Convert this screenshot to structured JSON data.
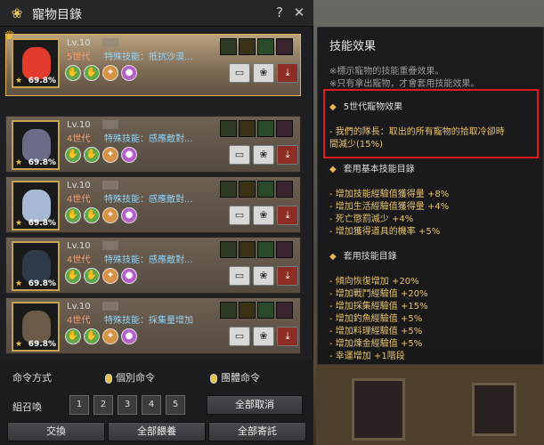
{
  "window": {
    "title": "寵物目錄",
    "help": "?",
    "close": "✕"
  },
  "pets": [
    {
      "level": "Lv.10",
      "generation": "5世代",
      "skill": "特殊技能：抵抗沙漠...",
      "percent": "69.8%",
      "selected": true
    },
    {
      "level": "Lv.10",
      "generation": "4世代",
      "skill": "特殊技能：感應敵對...",
      "percent": "69.8%",
      "selected": false
    },
    {
      "level": "Lv.10",
      "generation": "4世代",
      "skill": "特殊技能：感應敵對...",
      "percent": "69.8%",
      "selected": false
    },
    {
      "level": "Lv.10",
      "generation": "4世代",
      "skill": "特殊技能：感應敵對...",
      "percent": "69.8%",
      "selected": false
    },
    {
      "level": "Lv.10",
      "generation": "4世代",
      "skill": "特殊技能：採集量增加",
      "percent": "69.8%",
      "selected": false
    }
  ],
  "command": {
    "label": "命令方式",
    "individual": "個別命令",
    "group": "團體命令"
  },
  "summon": {
    "label": "組召喚",
    "slots": [
      "1",
      "2",
      "3",
      "4",
      "5"
    ],
    "cancel_all": "全部取消"
  },
  "actions": {
    "exchange": "交換",
    "feed_all": "全部餵養",
    "deposit_all": "全部寄託"
  },
  "skill_panel": {
    "title": "技能效果",
    "note1": "※標示寵物的技能重疊效果。",
    "note2": "※只有拿出寵物，才會套用技能效果。",
    "gen5_title": "5世代寵物效果",
    "gen5_text1": "- 我們的隊長：取出的所有寵物的拾取冷卻時",
    "gen5_text2": "間減少(15%)",
    "basic_title": "套用基本技能目錄",
    "basic_items": [
      "- 增加技能經驗值獲得量 +8%",
      "- 增加生活經驗值獲得量 +4%",
      "- 死亡懲罰減少 +4%",
      "- 增加獲得道具的機率 +5%"
    ],
    "skill_title": "套用技能目錄",
    "skill_items": [
      "- 傾向恢復增加 +20%",
      "- 增加戰鬥經驗值 +20%",
      "- 增加採集經驗值 +15%",
      "- 增加釣魚經驗值 +5%",
      "- 增加料理經驗值 +5%",
      "- 增加煉金經驗值 +5%",
      "- 幸運增加 +1階段"
    ]
  }
}
